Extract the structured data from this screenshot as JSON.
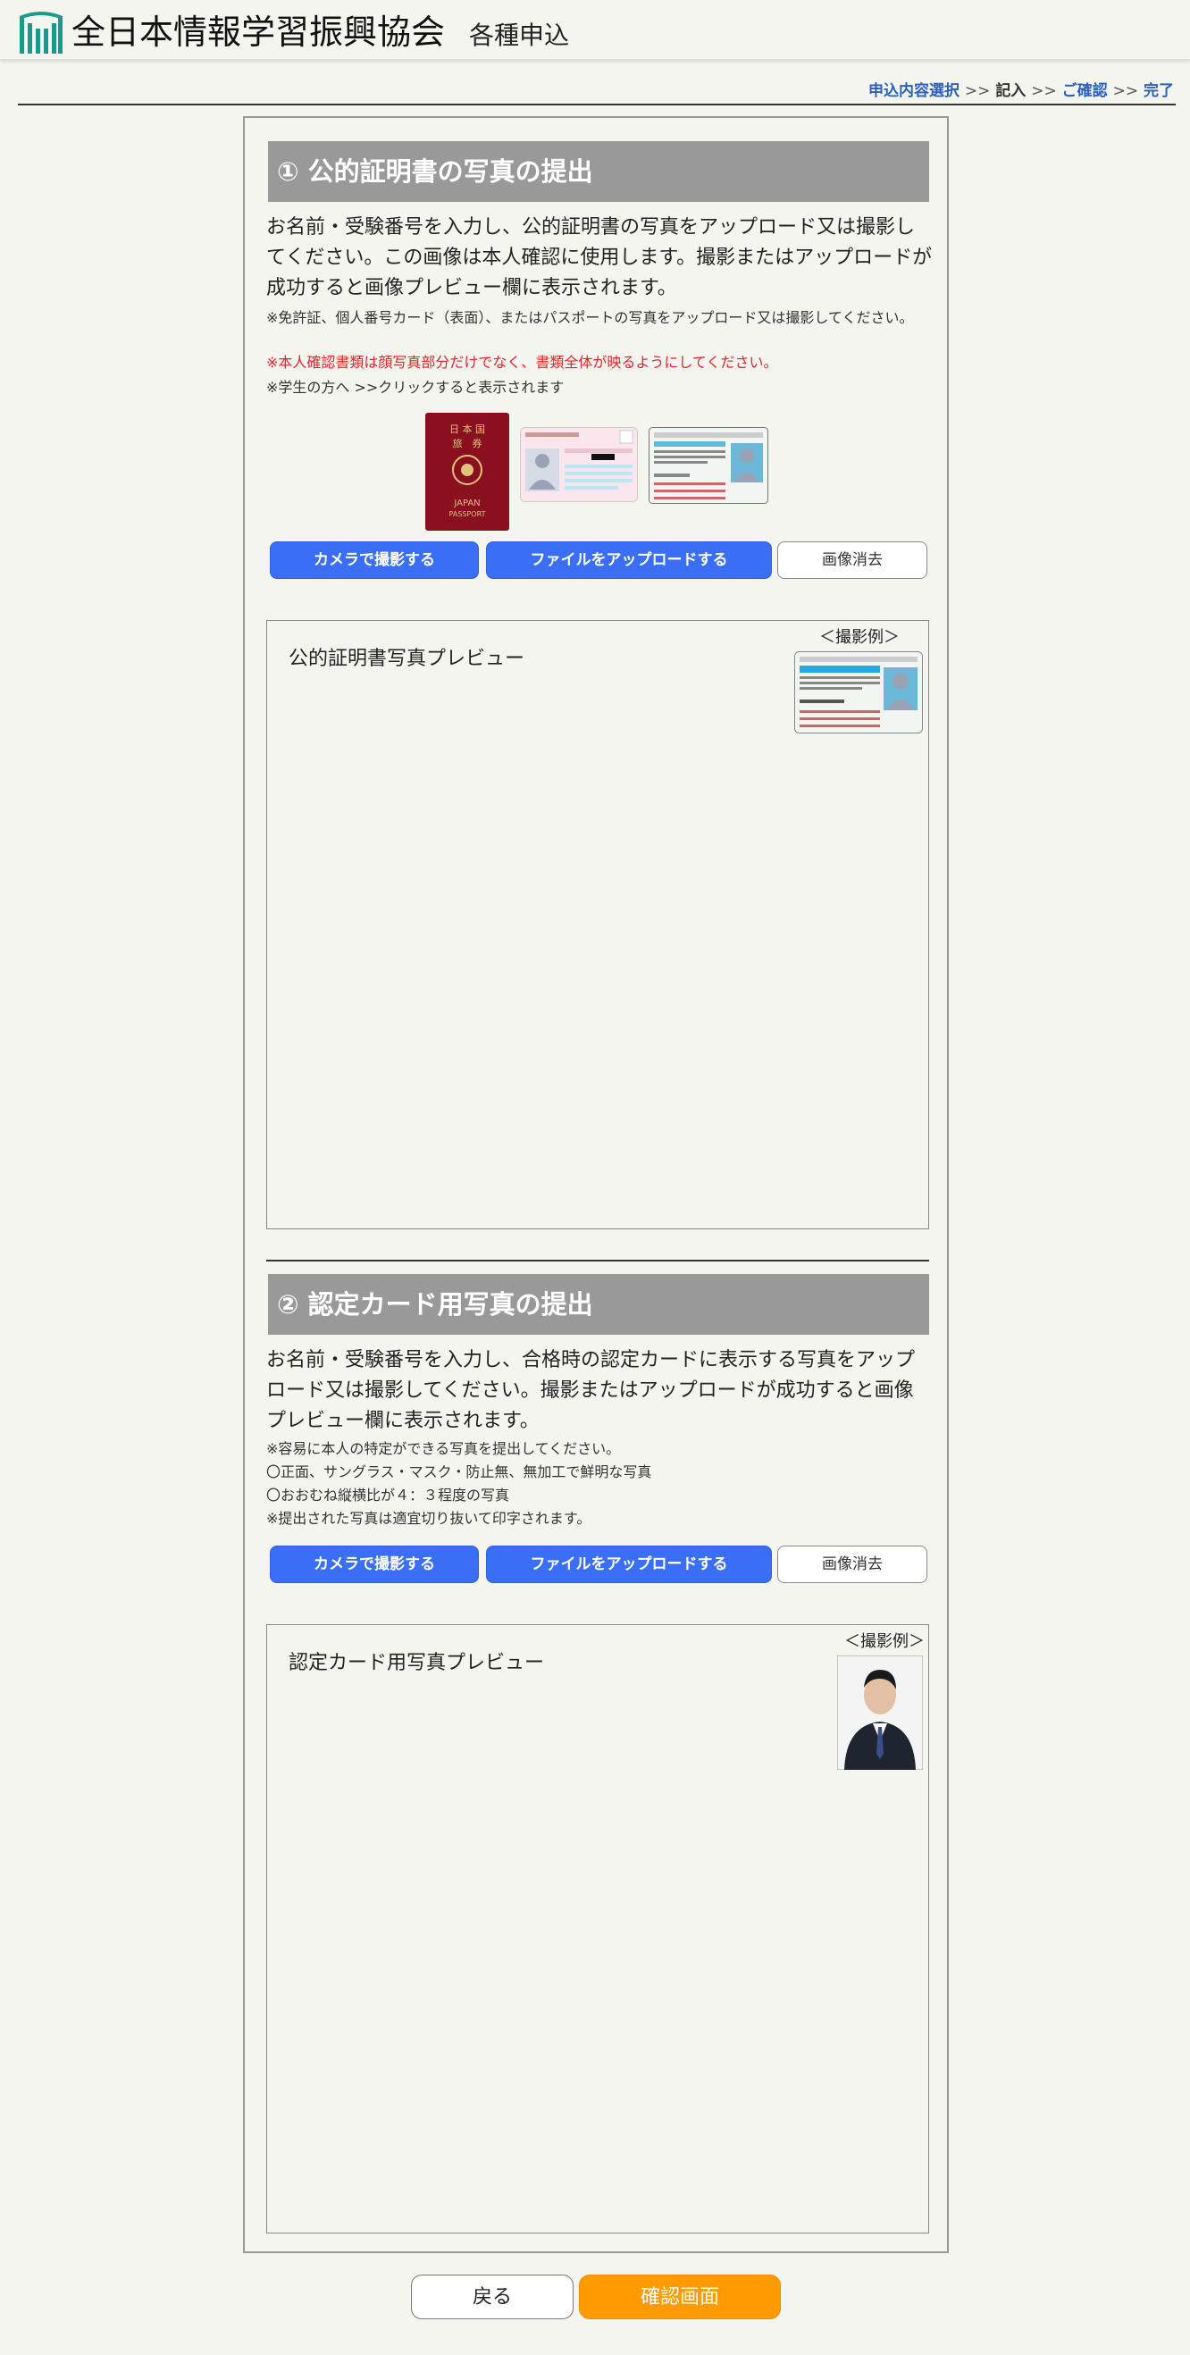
{
  "header": {
    "org_name": "全日本情報学習振興協会",
    "subtitle": "各種申込"
  },
  "breadcrumb": {
    "step1": "申込内容選択",
    "sep": ">>",
    "step2": "記入",
    "step3": "ご確認",
    "step4": "完了"
  },
  "section1": {
    "title": "① 公的証明書の写真の提出",
    "description": "お名前・受験番号を入力し、公的証明書の写真をアップロード又は撮影してください。この画像は本人確認に使用します。撮影またはアップロードが成功すると画像プレビュー欄に表示されます。",
    "note1": "※免許証、個人番号カード（表面）、またはパスポートの写真をアップロード又は撮影してください。",
    "note2": "※本人確認書類は顔写真部分だけでなく、書類全体が映るようにしてください。",
    "note3": "※学生の方へ >>クリックすると表示されます",
    "passport_text": {
      "line1": "日 本 国",
      "line2": "旅　券",
      "line3": "JAPAN",
      "line4": "PASSPORT"
    },
    "camera_button": "カメラで撮影する",
    "upload_button": "ファイルをアップロードする",
    "clear_button": "画像消去",
    "preview_label": "公的証明書写真プレビュー",
    "example_label": "＜撮影例＞"
  },
  "section2": {
    "title": "② 認定カード用写真の提出",
    "description": "お名前・受験番号を入力し、合格時の認定カードに表示する写真をアップロード又は撮影してください。撮影またはアップロードが成功すると画像プレビュー欄に表示されます。",
    "note1": "※容易に本人の特定ができる写真を提出してください。",
    "note2": "〇正面、サングラス・マスク・防止無、無加工で鮮明な写真",
    "note3": "〇おおむね縦横比が４：３程度の写真",
    "note4": "※提出された写真は適宜切り抜いて印字されます。",
    "camera_button": "カメラで撮影する",
    "upload_button": "ファイルをアップロードする",
    "clear_button": "画像消去",
    "preview_label": "認定カード用写真プレビュー",
    "example_label": "＜撮影例＞"
  },
  "footer": {
    "back_button": "戻る",
    "confirm_button": "確認画面"
  },
  "colors": {
    "accent_blue": "#3a6ff5",
    "confirm_orange": "#ff9a00",
    "section_gray": "#999999",
    "warning_red": "#e8212a",
    "logo_teal": "#1a9a8a",
    "passport_red": "#8a1020"
  }
}
